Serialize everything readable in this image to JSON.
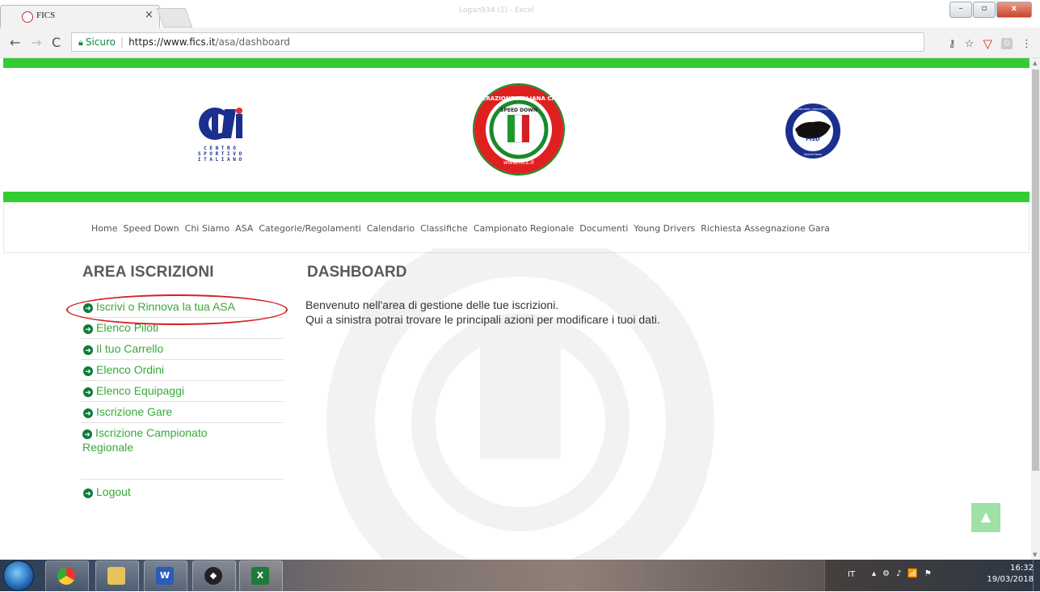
{
  "browser": {
    "tab_title": "FICS",
    "tab_close": "×",
    "window_title_blurred": "Logan934 (1) - Excel",
    "window_buttons": {
      "minimize": "–",
      "restore": "▫",
      "close": "x"
    },
    "secure_label": "Sicuro",
    "url_host": "https://www.fics.it",
    "url_path": "/asa/dashboard",
    "icons": [
      "back-arrow-icon",
      "forward-arrow-icon",
      "reload-icon",
      "lock-icon",
      "key-icon",
      "star-icon",
      "shield-extension-icon",
      "g-extension-icon",
      "menu-dots-icon"
    ]
  },
  "header": {
    "logos": [
      "CSI Centro Sportivo Italiano",
      "Federazione Italiana Carts Speed Down",
      "FISD Federation International Speed Down"
    ],
    "csi_text": [
      "C E N T R O",
      "S P O R T I V O",
      "I T A L I A N O"
    ],
    "fics_ring_top": "FEDERAZIONE ITALIANA CARTS",
    "fics_inner": "SPEED DOWN",
    "fics_bottom": "www.fics.it",
    "fisd_text": "FISD",
    "fisd_ring_top": "Federation International",
    "fisd_ring_bottom": "Speed Down"
  },
  "nav": {
    "items": [
      "Home",
      "Speed Down",
      "Chi Siamo",
      "ASA",
      "Categorie/Regolamenti",
      "Calendario",
      "Classifiche",
      "Campionato Regionale",
      "Documenti",
      "Young Drivers",
      "Richiesta Assegnazione Gara"
    ]
  },
  "sidebar": {
    "title": "AREA ISCRIZIONI",
    "links": [
      "Iscrivi o Rinnova la tua ASA",
      "Elenco Piloti",
      "Il tuo Carrello",
      "Elenco Ordini",
      "Elenco Equipaggi",
      "Iscrizione Gare",
      "Iscrizione Campionato Regionale"
    ],
    "logout": "Logout"
  },
  "main": {
    "title": "DASHBOARD",
    "line1": "Benvenuto nell'area di gestione delle tue iscrizioni.",
    "line2": "Qui a sinistra potrai trovare le principali azioni per modificare i tuoi dati."
  },
  "taskbar": {
    "apps": [
      "start-button",
      "chrome",
      "file-explorer",
      "word",
      "inkscape",
      "excel"
    ],
    "language": "IT",
    "time": "16:32",
    "date": "19/03/2018"
  },
  "colors": {
    "accent_green": "#33cc33",
    "link_green": "#3aa83a",
    "annotation_red": "#d42020"
  }
}
